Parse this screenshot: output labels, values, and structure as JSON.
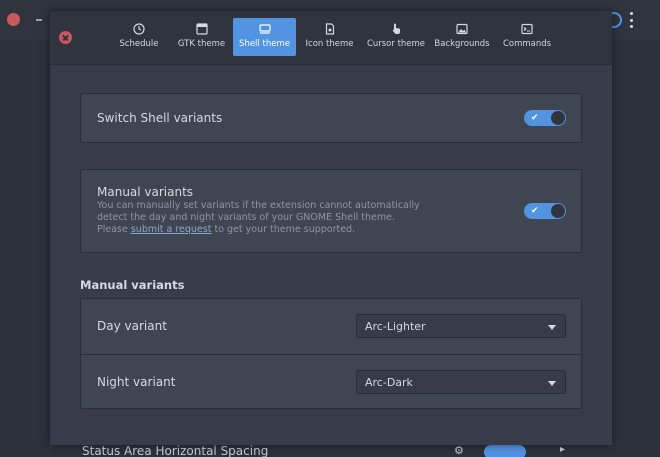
{
  "tabs": [
    {
      "label": "Schedule",
      "icon": "clock-icon"
    },
    {
      "label": "GTK theme",
      "icon": "window-icon"
    },
    {
      "label": "Shell theme",
      "icon": "shell-icon"
    },
    {
      "label": "Icon theme",
      "icon": "file-image-icon"
    },
    {
      "label": "Cursor theme",
      "icon": "pointer-hand-icon"
    },
    {
      "label": "Backgrounds",
      "icon": "image-icon"
    },
    {
      "label": "Commands",
      "icon": "terminal-icon"
    }
  ],
  "active_tab": "Shell theme",
  "switch_shell": {
    "label": "Switch Shell variants",
    "on": true
  },
  "manual_variants_toggle": {
    "title": "Manual variants",
    "desc_line1": "You can manually set variants if the extension cannot automatically",
    "desc_line2": "detect the day and night variants of your GNOME Shell theme.",
    "desc_prefix": "Please ",
    "desc_link": "submit a request",
    "desc_suffix": " to get your theme supported.",
    "on": true
  },
  "manual_section": {
    "title": "Manual variants",
    "day": {
      "label": "Day variant",
      "value": "Arc-Lighter"
    },
    "night": {
      "label": "Night variant",
      "value": "Arc-Dark"
    }
  },
  "background": {
    "bottom_row_label": "Status Area Horizontal Spacing"
  },
  "colors": {
    "accent": "#5294e2",
    "close": "#cc575d",
    "window_bg": "#383c4a",
    "frame_bg": "#404552"
  }
}
